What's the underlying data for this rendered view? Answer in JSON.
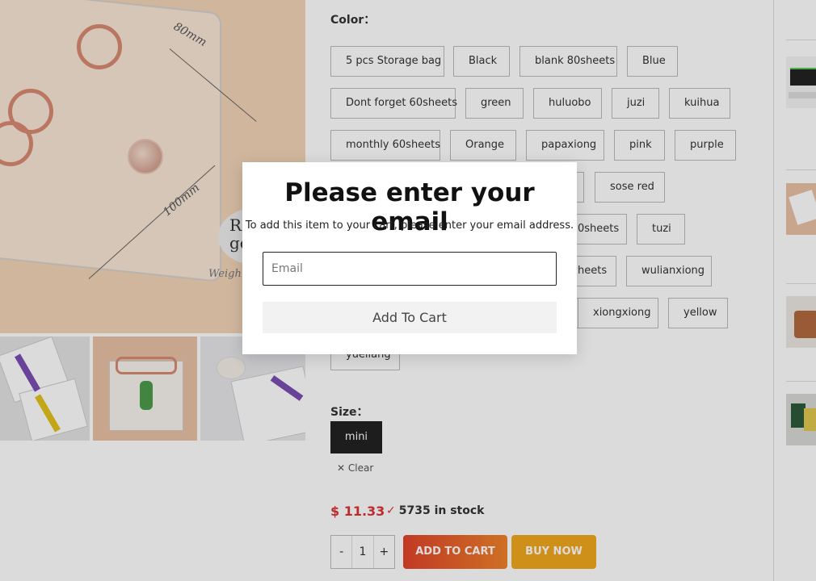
{
  "product_image": {
    "dim_top": "80mm",
    "dim_side": "100mm",
    "badge_text": "Ro\ngo",
    "weigh_text": "Weigh"
  },
  "color": {
    "label": "Color：",
    "options": [
      "5 pcs Storage bag",
      "Black",
      "blank 80sheets",
      "Blue",
      "Dont forget 60sheets",
      "green",
      "huluobo",
      "juzi",
      "kuihua",
      "monthly 60sheets",
      "Orange",
      "papaxiong",
      "pink",
      "purple",
      "sose red",
      "0sheets",
      "tuzi",
      "heets",
      "wulianxiong",
      "xiongxiong",
      "yellow",
      "yueliang"
    ]
  },
  "size": {
    "label": "Size：",
    "selected": "mini",
    "clear_label": "Clear"
  },
  "purchase": {
    "price": "$ 11.33",
    "stock": "5735 in stock",
    "qty_minus": "-",
    "qty_value": "1",
    "qty_plus": "+",
    "add_to_cart": "ADD TO CART",
    "buy_now": "BUY NOW"
  },
  "modal": {
    "title": "Please enter your email",
    "description": "To add this item to your cart, please enter your email address.",
    "email_placeholder": "Email",
    "button_label": "Add To Cart"
  },
  "icons": {
    "check": "check-icon",
    "clear": "close-icon"
  }
}
